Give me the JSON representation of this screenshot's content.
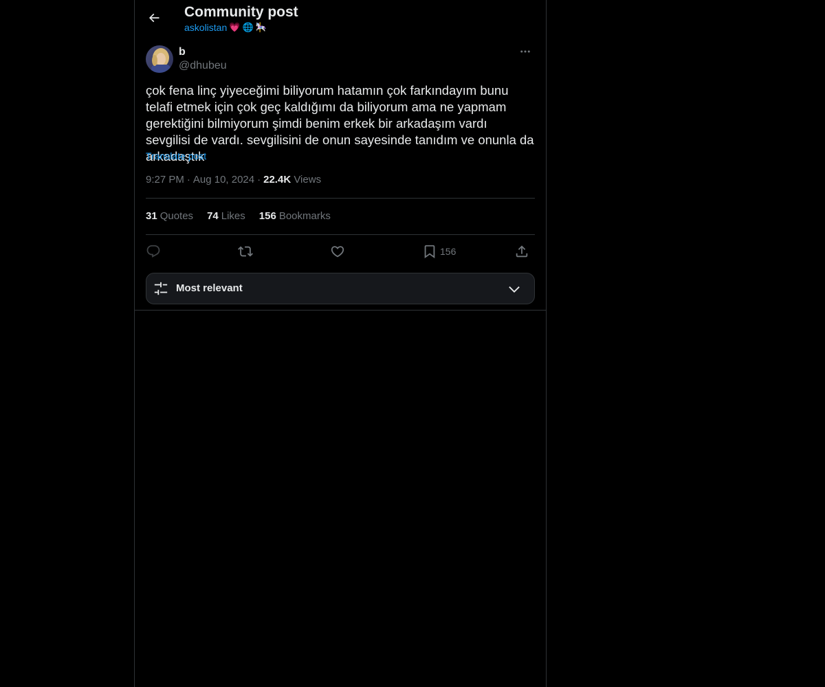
{
  "header": {
    "title": "Community post",
    "community_name": "askolistan",
    "community_emojis": [
      "💗",
      "🌐",
      "🎠"
    ]
  },
  "author": {
    "name": "b",
    "handle": "@dhubeu"
  },
  "post": {
    "text": "çok fena linç yiyeceğimi biliyorum hatamın çok farkındayım bunu telafi etmek için çok geç kaldığımı da biliyorum ama ne yapmam gerektiğini bilmiyorum şimdi benim erkek bir arkadaşım vardı sevgilisi de vardı. sevgilisini de onun sayesinde tanıdım ve onunla da arkadaştık",
    "translate_label": "Translate post",
    "time": "9:27 PM",
    "date": "Aug 10, 2024",
    "views_count": "22.4K",
    "views_label": "Views",
    "separator": "·"
  },
  "stats": {
    "quotes_count": "31",
    "quotes_label": "Quotes",
    "likes_count": "74",
    "likes_label": "Likes",
    "bookmarks_count": "156",
    "bookmarks_label": "Bookmarks"
  },
  "actions": {
    "reply_icon": "reply-icon",
    "repost_icon": "repost-icon",
    "like_icon": "heart-icon",
    "bookmark_icon": "bookmark-icon",
    "bookmark_count": "156",
    "share_icon": "share-icon"
  },
  "sort": {
    "label": "Most relevant"
  },
  "colors": {
    "background": "#000000",
    "text_primary": "#e7e9ea",
    "text_secondary": "#71767b",
    "accent": "#1d9bf0",
    "border": "#2f3336"
  }
}
